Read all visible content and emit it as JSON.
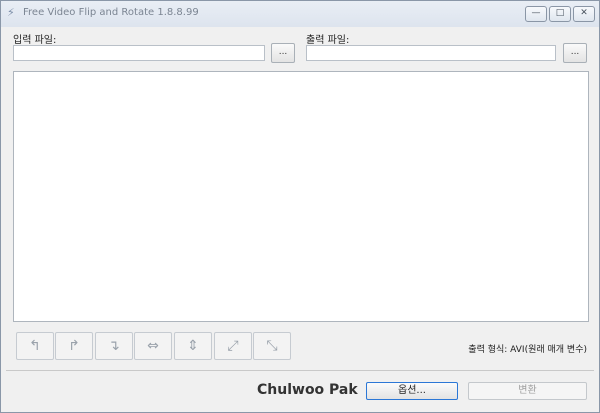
{
  "window": {
    "title": "Free Video Flip and Rotate 1.8.8.99"
  },
  "input": {
    "label": "입력 파일:",
    "value": "",
    "browse": "..."
  },
  "output": {
    "label": "출력 파일:",
    "value": "",
    "browse": "..."
  },
  "format": {
    "text": "출력 형식: AVI(원래 매개 변수)"
  },
  "footer": {
    "author": "Chulwoo Pak",
    "options_label": "옵션...",
    "convert_label": "변환"
  },
  "icons": [
    "app-icon",
    "rotate-left-icon",
    "rotate-right-icon",
    "rotate-180-icon",
    "flip-horizontal-icon",
    "flip-vertical-icon",
    "transpose-icon",
    "transverse-icon"
  ]
}
